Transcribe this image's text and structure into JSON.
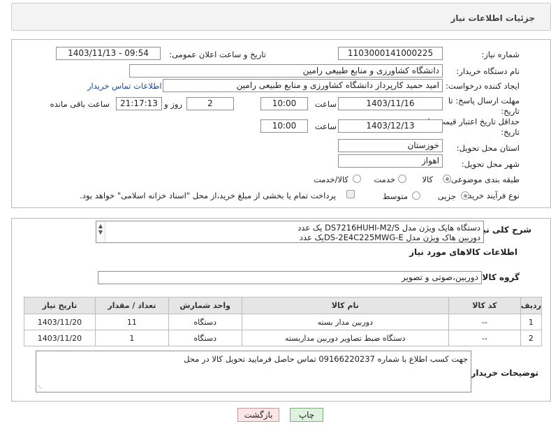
{
  "header": {
    "title": "جزئیات اطلاعات نیاز"
  },
  "form": {
    "need_number_label": "شماره نیاز:",
    "need_number": "1103000141000225",
    "announce_datetime_label": "تاریخ و ساعت اعلان عمومی:",
    "announce_datetime": "1403/11/13 - 09:54",
    "buyer_org_label": "نام دستگاه خریدار:",
    "buyer_org": "دانشگاه کشاورزی و منابع طبیعی رامین",
    "requester_label": "ایجاد کننده درخواست:",
    "requester": "امید حمید کارپرداز دانشگاه کشاورزی و منابع طبیعی رامین",
    "buyer_contact_link": "اطلاعات تماس خریدار",
    "deadline_label_1": "مهلت ارسال پاسخ: تا",
    "deadline_label_2": "تاریخ:",
    "deadline_date": "1403/11/16",
    "time_label": "ساعت",
    "deadline_time": "10:00",
    "days_value": "2",
    "days_label": "روز و",
    "remaining_time": "21:17:13",
    "remaining_label": "ساعت باقی مانده",
    "validity_label_1": "حداقل تاریخ اعتبار قیمت: تا",
    "validity_label_2": "تاریخ:",
    "validity_date": "1403/12/13",
    "validity_time": "10:00",
    "province_label": "استان محل تحویل:",
    "province": "خوزستان",
    "city_label": "شهر محل تحویل:",
    "city": "اهواز",
    "category_label": "طبقه بندی موضوعی:",
    "category_options": [
      "کالا",
      "خدمت",
      "کالا/خدمت"
    ],
    "category_selected": "کالا",
    "process_label": "نوع فرآیند خرید :",
    "process_options": [
      "جزیی",
      "متوسط"
    ],
    "process_selected": "جزیی",
    "payment_note": "پرداخت تمام یا بخشی از مبلغ خرید،از محل \"اسناد خزانه اسلامی\" خواهد بود."
  },
  "description": {
    "general_label": "شرح کلی نیاز:",
    "general_lines": [
      "دستگاه هایک ویژن مدل DS7216HUHI-M2/S یک عدد",
      "دوربین هاک ویژن مدل DS-2E4C225MWG-Eیک عدد"
    ],
    "goods_info_title": "اطلاعات کالاهای مورد نیاز",
    "goods_group_label": "گروه کالا:",
    "goods_group": "دوربین،صوتی و تصویر"
  },
  "table": {
    "headers": [
      "ردیف",
      "کد کالا",
      "نام کالا",
      "واحد شمارش",
      "تعداد / مقدار",
      "تاریخ نیاز"
    ],
    "rows": [
      [
        "1",
        "--",
        "دوربین مدار بسته",
        "دستگاه",
        "11",
        "1403/11/20"
      ],
      [
        "2",
        "--",
        "دستگاه ضبط تصاویر دوربین مداربسته",
        "دستگاه",
        "1",
        "1403/11/20"
      ]
    ]
  },
  "buyer_notes": {
    "label": "توضیحات خریدار:",
    "text": "جهت کسب اطلاع با شماره 09166220237 تماس حاصل فرمایید تحویل کالا در محل"
  },
  "buttons": {
    "print": "چاپ",
    "back": "بازگشت"
  },
  "colors": {
    "link": "#1a4aa8",
    "print_bg": "#dff2df",
    "back_bg": "#fbe6e6",
    "header_bg": "#f3f3f3"
  }
}
